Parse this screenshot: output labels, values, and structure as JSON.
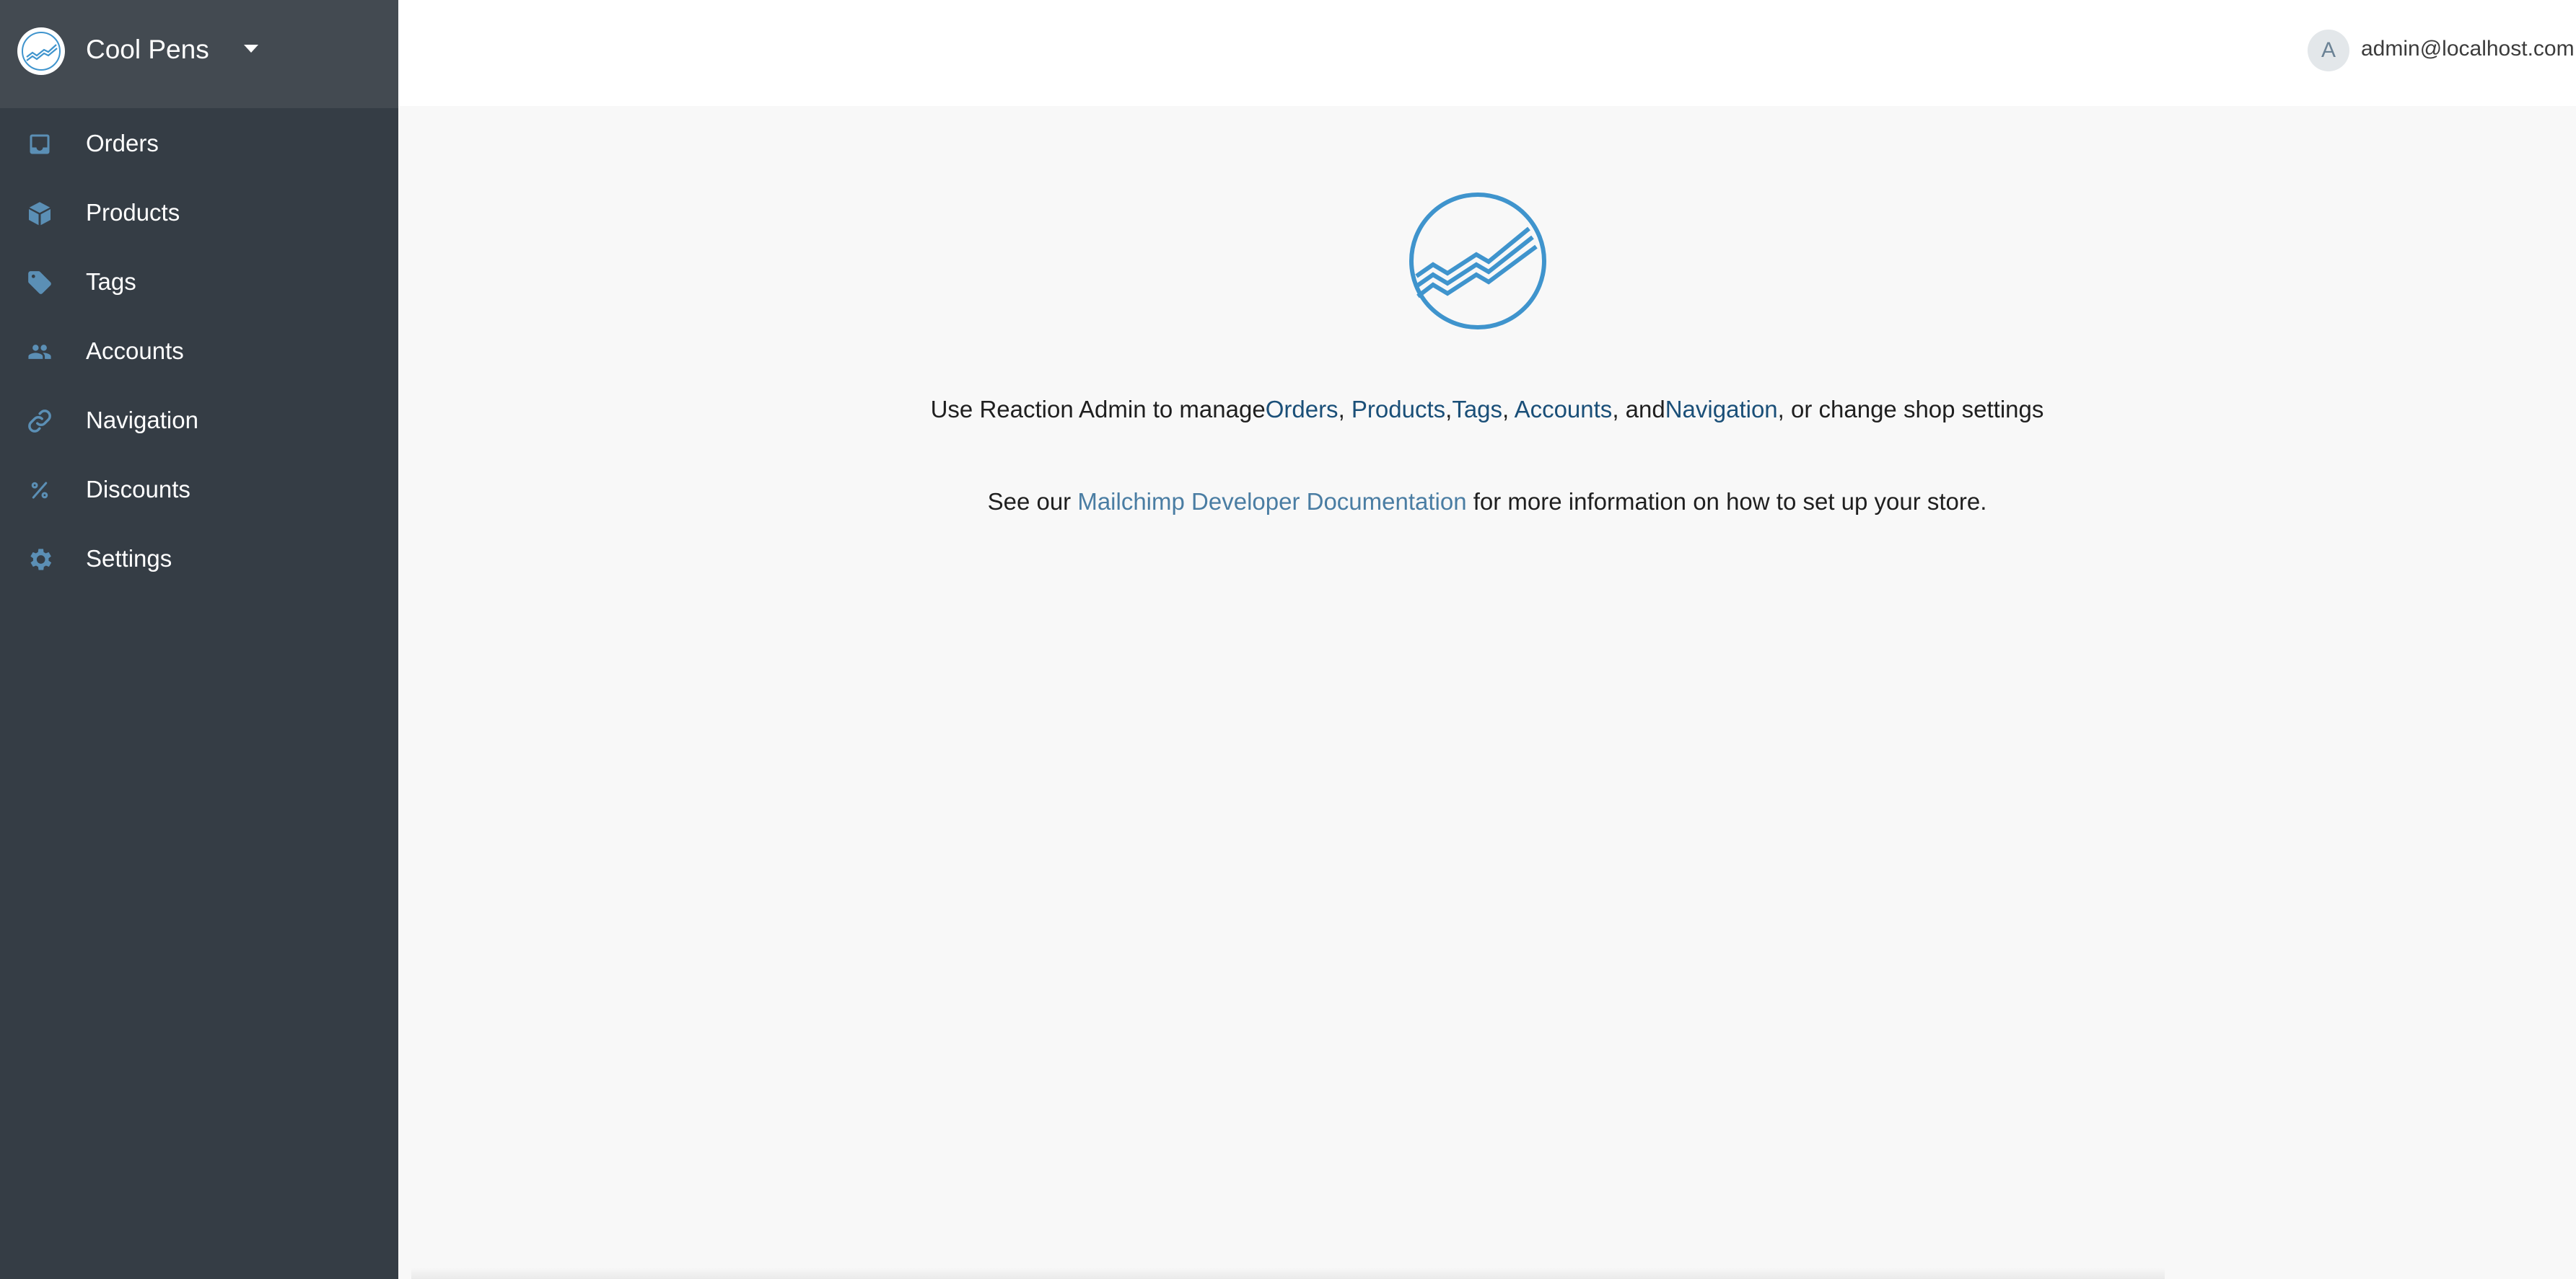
{
  "shop": {
    "name": "Cool Pens",
    "logo_icon": "reaction-logo-icon",
    "menu_icon": "caret-down-icon"
  },
  "sidebar": {
    "items": [
      {
        "label": "Orders",
        "icon": "inbox-icon"
      },
      {
        "label": "Products",
        "icon": "box-icon"
      },
      {
        "label": "Tags",
        "icon": "tag-icon"
      },
      {
        "label": "Accounts",
        "icon": "users-icon"
      },
      {
        "label": "Navigation",
        "icon": "link-icon"
      },
      {
        "label": "Discounts",
        "icon": "percent-icon"
      },
      {
        "label": "Settings",
        "icon": "gear-icon"
      }
    ]
  },
  "user": {
    "avatar_initial": "A",
    "email": "admin@localhost.com"
  },
  "main": {
    "intro_prefix": "Use Reaction Admin to manage",
    "link_orders": "Orders",
    "sep1": ", ",
    "link_products": "Products",
    "sep2": ",",
    "link_tags": "Tags",
    "sep3": ", ",
    "link_accounts": "Accounts",
    "sep4": ", and",
    "link_navigation": "Navigation",
    "intro_suffix": ", or change shop settings",
    "docs_prefix": "See our ",
    "docs_link": "Mailchimp Developer Documentation",
    "docs_suffix": " for more information on how to set up your store."
  },
  "colors": {
    "sidebar_bg": "#353d45",
    "sidebar_header_bg": "#434a51",
    "icon_blue": "#5b8fb5",
    "brand_blue": "#3f94cd",
    "link_dark": "#1a4f78",
    "link_light": "#4a7da3",
    "content_bg": "#f8f8f8"
  }
}
